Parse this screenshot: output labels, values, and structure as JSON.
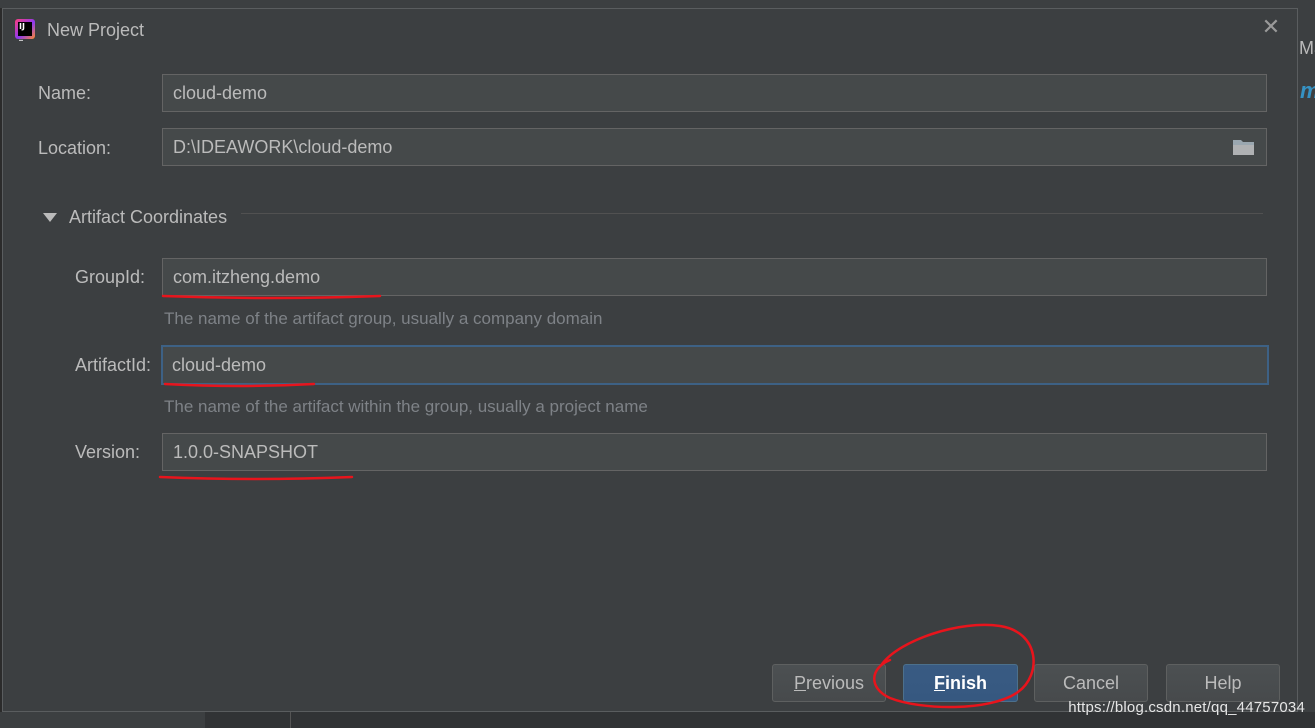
{
  "background": {
    "right_edge_text": "Ma",
    "right_edge_accent": "m",
    "watermark": "https://blog.csdn.net/qq_44757034"
  },
  "dialog": {
    "title": "New Project",
    "close_glyph": "✕",
    "name_label": "Name:",
    "name_value": "cloud-demo",
    "location_label": "Location:",
    "location_value": "D:\\IDEAWORK\\cloud-demo",
    "section_title": "Artifact Coordinates",
    "group_label": "GroupId:",
    "group_value": "com.itzheng.demo",
    "group_hint": "The name of the artifact group, usually a company domain",
    "artifact_label": "ArtifactId:",
    "artifact_value": "cloud-demo",
    "artifact_hint": "The name of the artifact within the group, usually a project name",
    "version_label": "Version:",
    "version_value": "1.0.0-SNAPSHOT",
    "buttons": {
      "previous_first": "P",
      "previous_rest": "revious",
      "finish_first": "F",
      "finish_rest": "inish",
      "cancel": "Cancel",
      "help": "Help"
    }
  },
  "colors": {
    "annotation_red": "#e8141c",
    "accent_blue": "#365880",
    "dialog_bg": "#3c3f41"
  },
  "icons": [
    "intellij-logo-icon",
    "close-icon",
    "folder-icon",
    "expand-triangle-icon"
  ]
}
